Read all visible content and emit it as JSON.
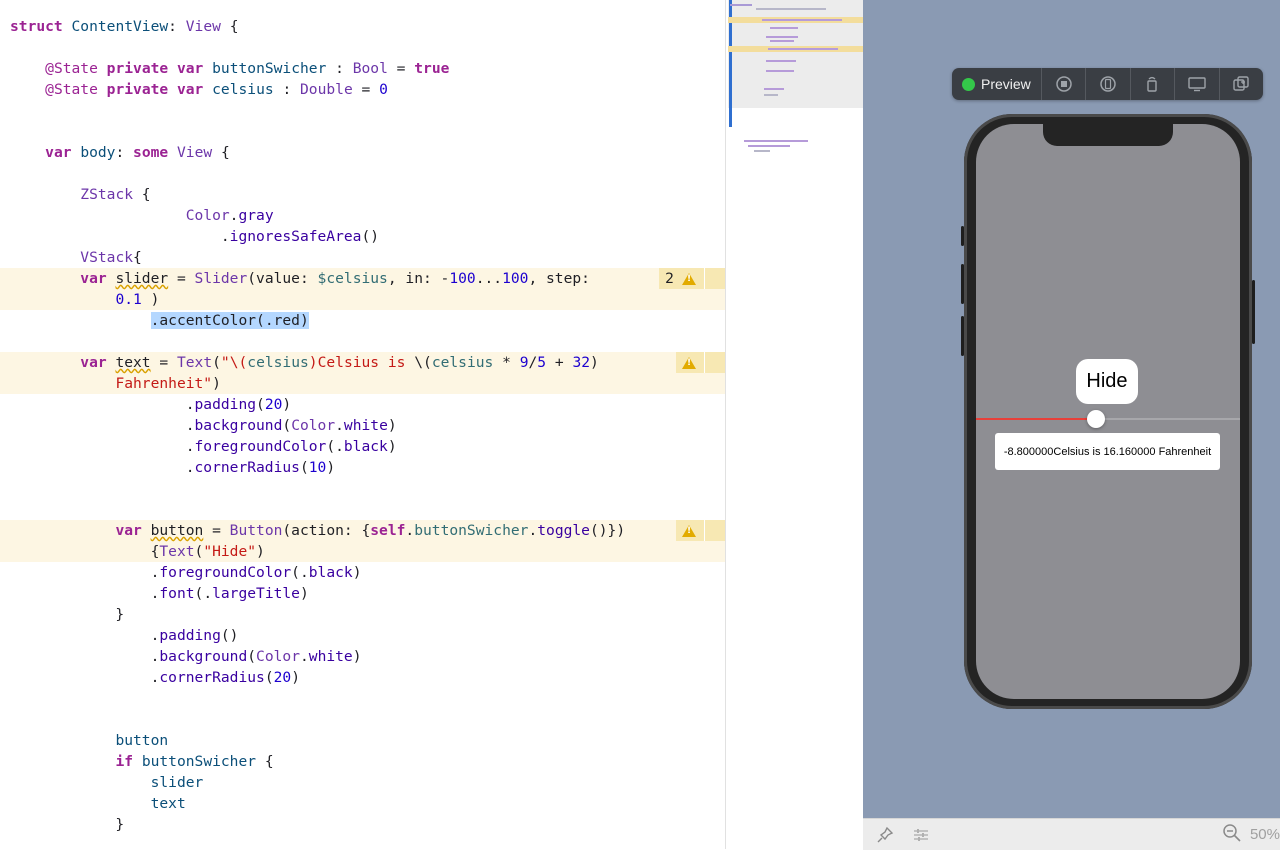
{
  "editor": {
    "lines": [
      [
        [
          "k",
          "struct"
        ],
        [
          "",
          " "
        ],
        [
          "t",
          "ContentView"
        ],
        [
          "",
          ": "
        ],
        [
          "ty",
          "View"
        ],
        [
          "",
          " {"
        ]
      ],
      [],
      [
        [
          "",
          "    "
        ],
        [
          "a",
          "@State"
        ],
        [
          "",
          " "
        ],
        [
          "k",
          "private"
        ],
        [
          "",
          " "
        ],
        [
          "k",
          "var"
        ],
        [
          "",
          " "
        ],
        [
          "t",
          "buttonSwicher"
        ],
        [
          "",
          " : "
        ],
        [
          "ty",
          "Bool"
        ],
        [
          "",
          " = "
        ],
        [
          "k",
          "true"
        ]
      ],
      [
        [
          "",
          "    "
        ],
        [
          "a",
          "@State"
        ],
        [
          "",
          " "
        ],
        [
          "k",
          "private"
        ],
        [
          "",
          " "
        ],
        [
          "k",
          "var"
        ],
        [
          "",
          " "
        ],
        [
          "t",
          "celsius"
        ],
        [
          "",
          " : "
        ],
        [
          "ty",
          "Double"
        ],
        [
          "",
          " = "
        ],
        [
          "n",
          "0"
        ]
      ],
      [],
      [],
      [
        [
          "",
          "    "
        ],
        [
          "k",
          "var"
        ],
        [
          "",
          " "
        ],
        [
          "t",
          "body"
        ],
        [
          "",
          ": "
        ],
        [
          "k",
          "some"
        ],
        [
          "",
          " "
        ],
        [
          "ty",
          "View"
        ],
        [
          "",
          " {"
        ]
      ],
      [],
      [
        [
          "",
          "        "
        ],
        [
          "ty",
          "ZStack"
        ],
        [
          "",
          " {"
        ]
      ],
      [
        [
          "",
          "                    "
        ],
        [
          "ty",
          "Color"
        ],
        [
          "",
          "."
        ],
        [
          "p",
          "gray"
        ]
      ],
      [
        [
          "",
          "                        ."
        ],
        [
          "p",
          "ignoresSafeArea"
        ],
        [
          "",
          "()"
        ]
      ],
      [
        [
          "",
          "        "
        ],
        [
          "ty",
          "VStack"
        ],
        [
          "",
          "{"
        ]
      ],
      [
        [
          "",
          "        "
        ],
        [
          "k",
          "var"
        ],
        [
          "",
          " "
        ],
        [
          "sq",
          "slider"
        ],
        [
          "",
          " = "
        ],
        [
          "ty",
          "Slider"
        ],
        [
          "",
          "(value: "
        ],
        [
          "f",
          "$celsius"
        ],
        [
          "",
          ", in: -"
        ],
        [
          "n",
          "100"
        ],
        [
          "",
          "..."
        ],
        [
          "n",
          "100"
        ],
        [
          "",
          ", step:"
        ]
      ],
      [
        [
          "",
          "            "
        ],
        [
          "n",
          "0.1"
        ],
        [
          "",
          " )"
        ]
      ],
      [
        [
          "",
          "                "
        ],
        [
          "sel",
          ".accentColor(.red)"
        ]
      ],
      [],
      [
        [
          "",
          "        "
        ],
        [
          "k",
          "var"
        ],
        [
          "",
          " "
        ],
        [
          "sq",
          "text"
        ],
        [
          "",
          " = "
        ],
        [
          "ty",
          "Text"
        ],
        [
          "",
          "("
        ],
        [
          "s",
          "\"\\("
        ],
        [
          "f",
          "celsius"
        ],
        [
          "s",
          ")Celsius is "
        ],
        [
          "",
          "\\("
        ],
        [
          "f",
          "celsius"
        ],
        [
          "",
          " * "
        ],
        [
          "n",
          "9"
        ],
        [
          "",
          "/"
        ],
        [
          "n",
          "5"
        ],
        [
          "",
          " + "
        ],
        [
          "n",
          "32"
        ],
        [
          "",
          ")"
        ]
      ],
      [
        [
          "",
          "            "
        ],
        [
          "s",
          "Fahrenheit\""
        ],
        [
          "",
          ")"
        ]
      ],
      [
        [
          "",
          "                    ."
        ],
        [
          "p",
          "padding"
        ],
        [
          "",
          "("
        ],
        [
          "n",
          "20"
        ],
        [
          "",
          ")"
        ]
      ],
      [
        [
          "",
          "                    ."
        ],
        [
          "p",
          "background"
        ],
        [
          "",
          "("
        ],
        [
          "ty",
          "Color"
        ],
        [
          "",
          "."
        ],
        [
          "p",
          "white"
        ],
        [
          "",
          ")"
        ]
      ],
      [
        [
          "",
          "                    ."
        ],
        [
          "p",
          "foregroundColor"
        ],
        [
          "",
          "(."
        ],
        [
          "p",
          "black"
        ],
        [
          "",
          ")"
        ]
      ],
      [
        [
          "",
          "                    ."
        ],
        [
          "p",
          "cornerRadius"
        ],
        [
          "",
          "("
        ],
        [
          "n",
          "10"
        ],
        [
          "",
          ")"
        ]
      ],
      [],
      [],
      [
        [
          "",
          "            "
        ],
        [
          "k",
          "var"
        ],
        [
          "",
          " "
        ],
        [
          "sq",
          "button"
        ],
        [
          "",
          " = "
        ],
        [
          "ty",
          "Button"
        ],
        [
          "",
          "(action: {"
        ],
        [
          "k",
          "self"
        ],
        [
          "",
          "."
        ],
        [
          "f",
          "buttonSwicher"
        ],
        [
          "",
          "."
        ],
        [
          "p",
          "toggle"
        ],
        [
          "",
          "()})"
        ]
      ],
      [
        [
          "",
          "                {"
        ],
        [
          "ty",
          "Text"
        ],
        [
          "",
          "("
        ],
        [
          "s",
          "\"Hide\""
        ],
        [
          "",
          ")"
        ]
      ],
      [
        [
          "",
          "                ."
        ],
        [
          "p",
          "foregroundColor"
        ],
        [
          "",
          "(."
        ],
        [
          "p",
          "black"
        ],
        [
          "",
          ")"
        ]
      ],
      [
        [
          "",
          "                ."
        ],
        [
          "p",
          "font"
        ],
        [
          "",
          "(."
        ],
        [
          "p",
          "largeTitle"
        ],
        [
          "",
          ")"
        ]
      ],
      [
        [
          "",
          "            }"
        ]
      ],
      [
        [
          "",
          "                ."
        ],
        [
          "p",
          "padding"
        ],
        [
          "",
          "()"
        ]
      ],
      [
        [
          "",
          "                ."
        ],
        [
          "p",
          "background"
        ],
        [
          "",
          "("
        ],
        [
          "ty",
          "Color"
        ],
        [
          "",
          "."
        ],
        [
          "p",
          "white"
        ],
        [
          "",
          ")"
        ]
      ],
      [
        [
          "",
          "                ."
        ],
        [
          "p",
          "cornerRadius"
        ],
        [
          "",
          "("
        ],
        [
          "n",
          "20"
        ],
        [
          "",
          ")"
        ]
      ],
      [],
      [],
      [
        [
          "",
          "            "
        ],
        [
          "t",
          "button"
        ]
      ],
      [
        [
          "",
          "            "
        ],
        [
          "k",
          "if"
        ],
        [
          "",
          " "
        ],
        [
          "t",
          "buttonSwicher"
        ],
        [
          "",
          " {"
        ]
      ],
      [
        [
          "",
          "                "
        ],
        [
          "t",
          "slider"
        ]
      ],
      [
        [
          "",
          "                "
        ],
        [
          "t",
          "text"
        ]
      ],
      [
        [
          "",
          "            }"
        ]
      ]
    ],
    "warnings": [
      {
        "count": "2",
        "icon": "warning-triangle-icon"
      },
      {
        "count": "",
        "icon": "warning-triangle-icon"
      },
      {
        "count": "",
        "icon": "warning-triangle-icon"
      }
    ]
  },
  "preview": {
    "toolbar": {
      "preview_label": "Preview",
      "icons": [
        "stop-icon",
        "device-settings-icon",
        "rotate-device-icon",
        "display-icon",
        "duplicate-icon"
      ]
    },
    "hide_button_label": "Hide",
    "slider": {
      "value": -8.8,
      "min": -100,
      "max": 100,
      "accent": "#e8403a"
    },
    "temperature_text": "-8.800000Celsius is 16.160000 Fahrenheit",
    "screen_color": "#8e8e93",
    "canvas_color": "#8a9ab3"
  },
  "bottom_bar": {
    "icons": [
      "pin-icon",
      "variants-icon",
      "zoom-out-icon"
    ],
    "zoom_label": "50%"
  }
}
